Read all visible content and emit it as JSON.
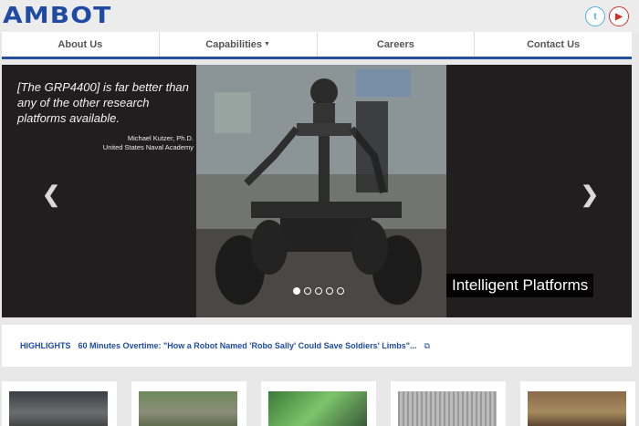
{
  "brand": {
    "logo_text": "AMBOT"
  },
  "social": [
    {
      "name": "twitter-icon",
      "glyph": "t"
    },
    {
      "name": "youtube-icon",
      "glyph": "▶"
    }
  ],
  "nav": {
    "items": [
      "About Us",
      "Capabilities",
      "Careers",
      "Contact Us"
    ]
  },
  "hero": {
    "quote": "[The GRP4400] is far better than any of the other research platforms available.",
    "author_name": "Michael Kutzer, Ph.D.",
    "author_org": "United States Naval Academy",
    "caption": "Intelligent Platforms",
    "prev_glyph": "❮",
    "next_glyph": "❯",
    "slides": 5,
    "active_slide": 1
  },
  "highlights": {
    "label": "HIGHLIGHTS",
    "link_text": "60 Minutes Overtime: \"How a Robot Named 'Robo Sally' Could Save Soldiers' Limbs\"...",
    "icon": "external-link-icon"
  },
  "colors": {
    "brand_blue": "#1f4ba5",
    "hero_bg": "#201e1f",
    "twitter": "#4ab0e2",
    "youtube": "#d0322a"
  }
}
